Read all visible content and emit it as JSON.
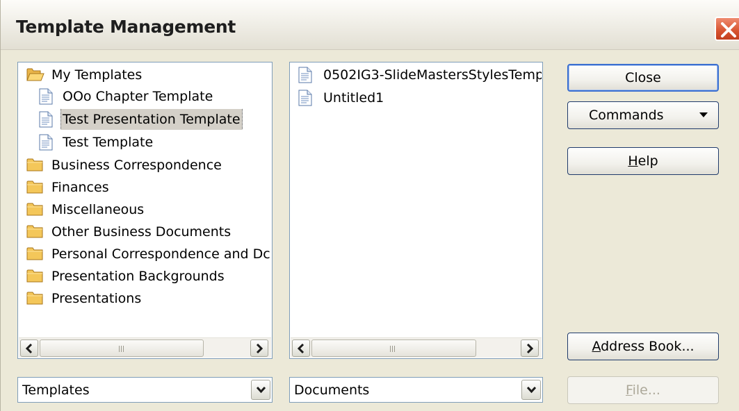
{
  "dialog": {
    "title": "Template Management"
  },
  "left_list": {
    "root": "My Templates",
    "children": [
      "OOo Chapter Template",
      "Test Presentation Template",
      "Test Template"
    ],
    "selected": "Test Presentation Template",
    "folders": [
      "Business Correspondence",
      "Finances",
      "Miscellaneous",
      "Other Business Documents",
      "Personal Correspondence and Dc",
      "Presentation Backgrounds",
      "Presentations"
    ],
    "icons": {
      "open_folder": "open-folder-icon",
      "folder": "folder-icon",
      "document": "document-icon"
    }
  },
  "right_list": {
    "items": [
      "0502IG3-SlideMastersStylesTemp",
      "Untitled1"
    ]
  },
  "buttons": {
    "close": "Close",
    "commands": "Commands",
    "help_mnemonic": "H",
    "help_rest": "elp",
    "address_book_mnemonic": "A",
    "address_book_rest": "ddress Book...",
    "file_mnemonic": "F",
    "file_rest": "ile..."
  },
  "combos": {
    "left_value": "Templates",
    "right_value": "Documents"
  },
  "colors": {
    "dialog_bg": "#ece9d8",
    "selection": "#d4d0c8",
    "border": "#7f9db9",
    "default_button_ring": "#3b6fd0",
    "disabled_text": "#aca899",
    "title_close_red": "#d7532f"
  }
}
